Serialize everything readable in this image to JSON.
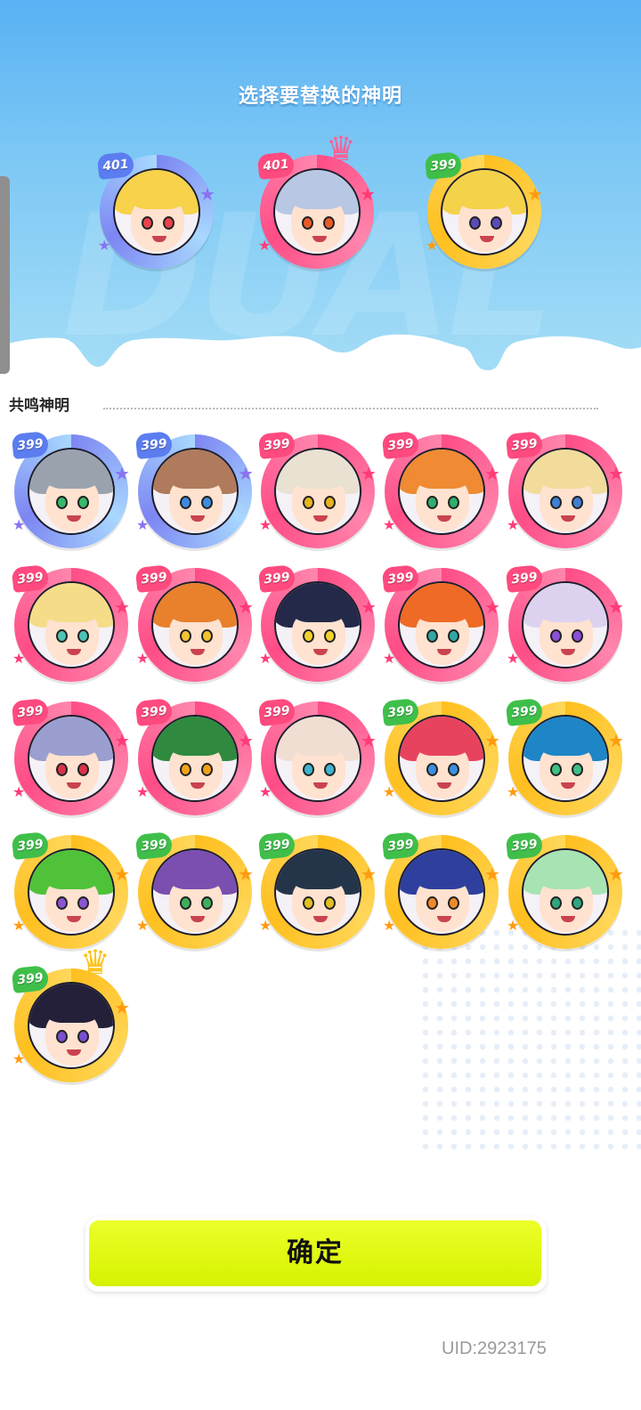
{
  "header": {
    "title": "选择要替换的神明",
    "bg_text": "DUAL"
  },
  "selected": [
    {
      "score": "401",
      "frame": "blue",
      "crown": false,
      "hair": "#f7d24a",
      "eyes": "#e8434d"
    },
    {
      "score": "401",
      "frame": "pink",
      "crown": true,
      "hair": "#b8c8e4",
      "eyes": "#e85a2a"
    },
    {
      "score": "399",
      "frame": "gold",
      "crown": false,
      "hair": "#f4d24a",
      "eyes": "#5b4bb9"
    }
  ],
  "resonance": {
    "label": "共鸣神明",
    "items": [
      {
        "score": "399",
        "frame": "blue",
        "crown": false,
        "hair": "#9aa3ad",
        "eyes": "#38b86a"
      },
      {
        "score": "399",
        "frame": "blue",
        "crown": false,
        "hair": "#b07b5c",
        "eyes": "#3c8be0"
      },
      {
        "score": "399",
        "frame": "pink",
        "crown": false,
        "hair": "#e9e1d2",
        "eyes": "#e8b31f"
      },
      {
        "score": "399",
        "frame": "pink",
        "crown": false,
        "hair": "#f08a33",
        "eyes": "#2fae6c"
      },
      {
        "score": "399",
        "frame": "pink",
        "crown": false,
        "hair": "#f1dc9c",
        "eyes": "#3f7fd3"
      },
      {
        "score": "399",
        "frame": "pink",
        "crown": false,
        "hair": "#f5dc88",
        "eyes": "#4dc3b6"
      },
      {
        "score": "399",
        "frame": "pink",
        "crown": false,
        "hair": "#e8802c",
        "eyes": "#f2c230"
      },
      {
        "score": "399",
        "frame": "pink",
        "crown": false,
        "hair": "#24294a",
        "eyes": "#f2d12b"
      },
      {
        "score": "399",
        "frame": "pink",
        "crown": false,
        "hair": "#ef6a25",
        "eyes": "#2fa7a2"
      },
      {
        "score": "399",
        "frame": "pink",
        "crown": false,
        "hair": "#dcd2f0",
        "eyes": "#8b4fd6"
      },
      {
        "score": "399",
        "frame": "pink",
        "crown": false,
        "hair": "#9a9fcf",
        "eyes": "#d8334a"
      },
      {
        "score": "399",
        "frame": "pink",
        "crown": false,
        "hair": "#2f8a3f",
        "eyes": "#f2a21a"
      },
      {
        "score": "399",
        "frame": "pink",
        "crown": false,
        "hair": "#f1ded3",
        "eyes": "#3fb5cf"
      },
      {
        "score": "399",
        "frame": "gold",
        "crown": false,
        "hair": "#e8435e",
        "eyes": "#3b8fe0"
      },
      {
        "score": "399",
        "frame": "gold",
        "crown": false,
        "hair": "#1e86c7",
        "eyes": "#3fbf86"
      },
      {
        "score": "399",
        "frame": "gold",
        "crown": false,
        "hair": "#4fc23a",
        "eyes": "#8b55d1"
      },
      {
        "score": "399",
        "frame": "gold",
        "crown": false,
        "hair": "#7a4fb0",
        "eyes": "#3fae5e"
      },
      {
        "score": "399",
        "frame": "gold",
        "crown": false,
        "hair": "#24354a",
        "eyes": "#e0c024"
      },
      {
        "score": "399",
        "frame": "gold",
        "crown": false,
        "hair": "#2e3f9e",
        "eyes": "#ef8a2a"
      },
      {
        "score": "399",
        "frame": "gold",
        "crown": false,
        "hair": "#a8e3b4",
        "eyes": "#2fa57e"
      },
      {
        "score": "399",
        "frame": "gold",
        "crown": true,
        "hair": "#24203a",
        "eyes": "#7a4fd0"
      }
    ]
  },
  "confirm_label": "确定",
  "uid_text": "UID:2923175",
  "colors": {
    "blue": {
      "ring": "#7d86f2",
      "ring2": "#a8d8ff",
      "score": "#5b7df0",
      "star": "#8a72f0"
    },
    "pink": {
      "ring": "#ff4d86",
      "ring2": "#ff86ad",
      "score": "#ff4a7f",
      "star": "#ff3b78"
    },
    "gold": {
      "ring": "#ffbf1f",
      "ring2": "#ffd75a",
      "score": "#ffb21a",
      "star": "#ff9b0f"
    },
    "score_green": "#3fbf4a",
    "score_purple": "#8a5cf0",
    "confirm": "#e6fb12"
  }
}
